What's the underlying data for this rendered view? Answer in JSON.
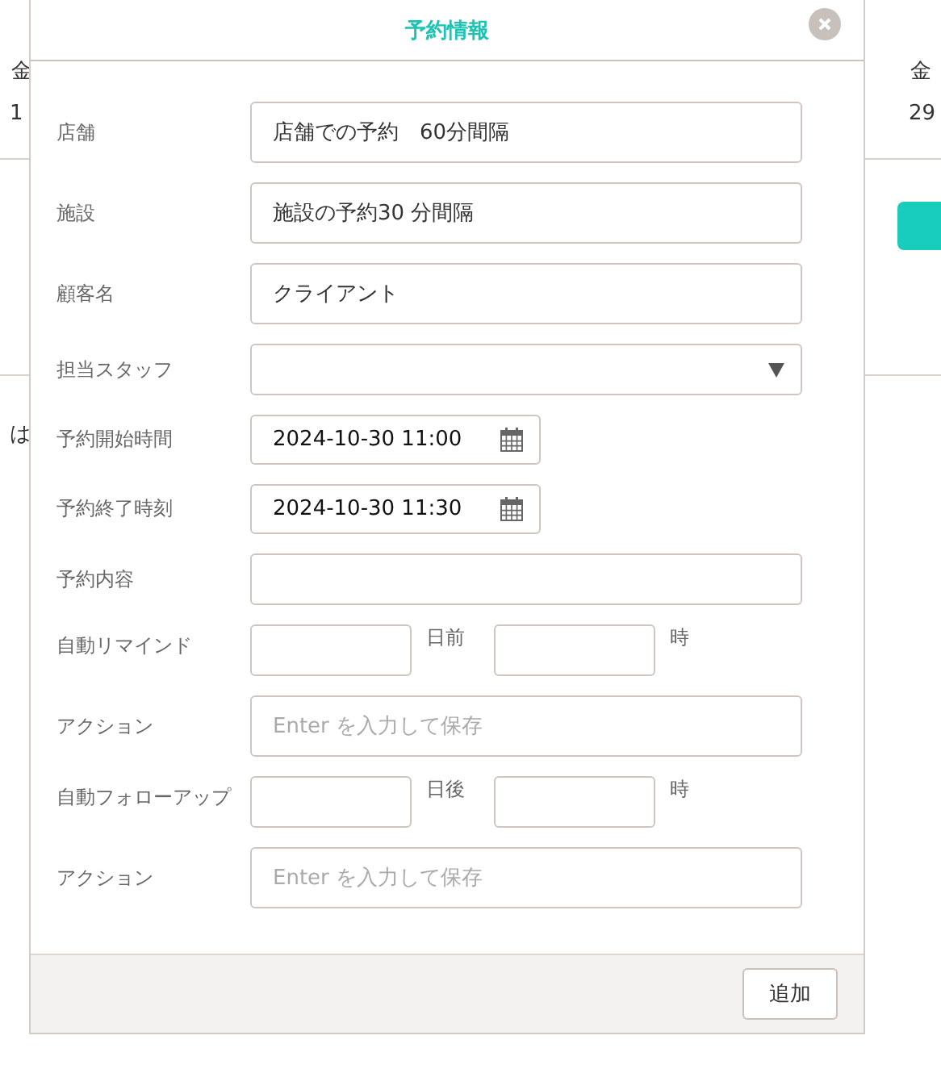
{
  "background": {
    "left_texts": [
      "金",
      "1"
    ],
    "left_note": "は",
    "right_texts": [
      "金",
      "29"
    ]
  },
  "dialog": {
    "title": "予約情報",
    "fields": [
      {
        "kind": "text",
        "label": "店舗",
        "value": "店舗での予約　60分間隔"
      },
      {
        "kind": "text",
        "label": "施設",
        "value": "施設の予約30 分間隔"
      },
      {
        "kind": "text",
        "label": "顧客名",
        "value": "クライアント"
      },
      {
        "kind": "select",
        "label": "担当スタッフ"
      },
      {
        "kind": "datetime",
        "label": "予約開始時間",
        "value": "2024-10-30 11:00"
      },
      {
        "kind": "datetime",
        "label": "予約終了時刻",
        "value": "2024-10-30 11:30"
      },
      {
        "kind": "short",
        "label": "予約内容"
      },
      {
        "kind": "offset",
        "label": "自動リマインド",
        "unit1": "日前",
        "unit2": "時"
      },
      {
        "kind": "action",
        "label": "アクション",
        "placeholder": "Enter を入力して保存"
      },
      {
        "kind": "offset",
        "label": "自動フォローアップ",
        "unit1": "日後",
        "unit2": "時"
      },
      {
        "kind": "action",
        "label": "アクション",
        "placeholder": "Enter を入力して保存"
      }
    ],
    "submit": "追加"
  }
}
